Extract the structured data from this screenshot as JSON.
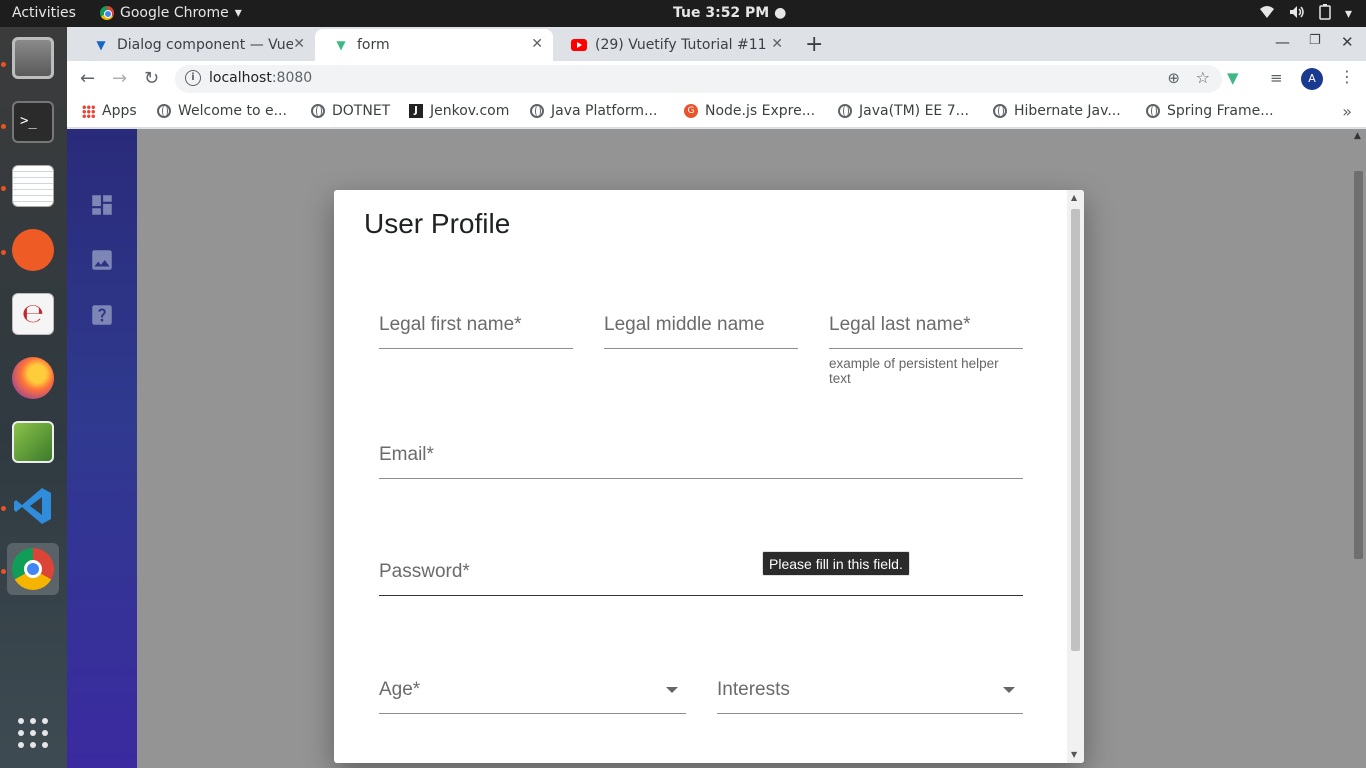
{
  "topbar": {
    "activities": "Activities",
    "app_name": "Google Chrome",
    "clock": "Tue   3:52 PM ●"
  },
  "browser": {
    "tabs": [
      {
        "title": "Dialog component — Vue",
        "active": false
      },
      {
        "title": "form",
        "active": true
      },
      {
        "title": "(29) Vuetify Tutorial #11 -",
        "active": false
      }
    ],
    "new_tab": "+",
    "url_host": "localhost",
    "url_port": ":8080",
    "profile_initial": "A",
    "bookmarks": [
      "Apps",
      "Welcome to e...",
      "DOTNET",
      "Jenkov.com",
      "Java Platform...",
      "Node.js Expre...",
      "Java(TM) EE 7...",
      "Hibernate Jav...",
      "Spring Frame..."
    ],
    "bookmarks_more": "»"
  },
  "dialog": {
    "title": "User Profile",
    "fields": {
      "first_name": "Legal first name*",
      "middle_name": "Legal middle name",
      "last_name": "Legal last name*",
      "last_name_hint": "example of persistent helper text",
      "email": "Email*",
      "password": "Password*",
      "age": "Age*",
      "interests": "Interests"
    }
  },
  "tooltip": {
    "text": "Please fill in this field."
  },
  "colors": {
    "drawer_top": "#2a2a7a",
    "drawer_bottom": "#3b2aa0",
    "overlay": "#949494",
    "ubuntu_orange": "#e95420"
  }
}
